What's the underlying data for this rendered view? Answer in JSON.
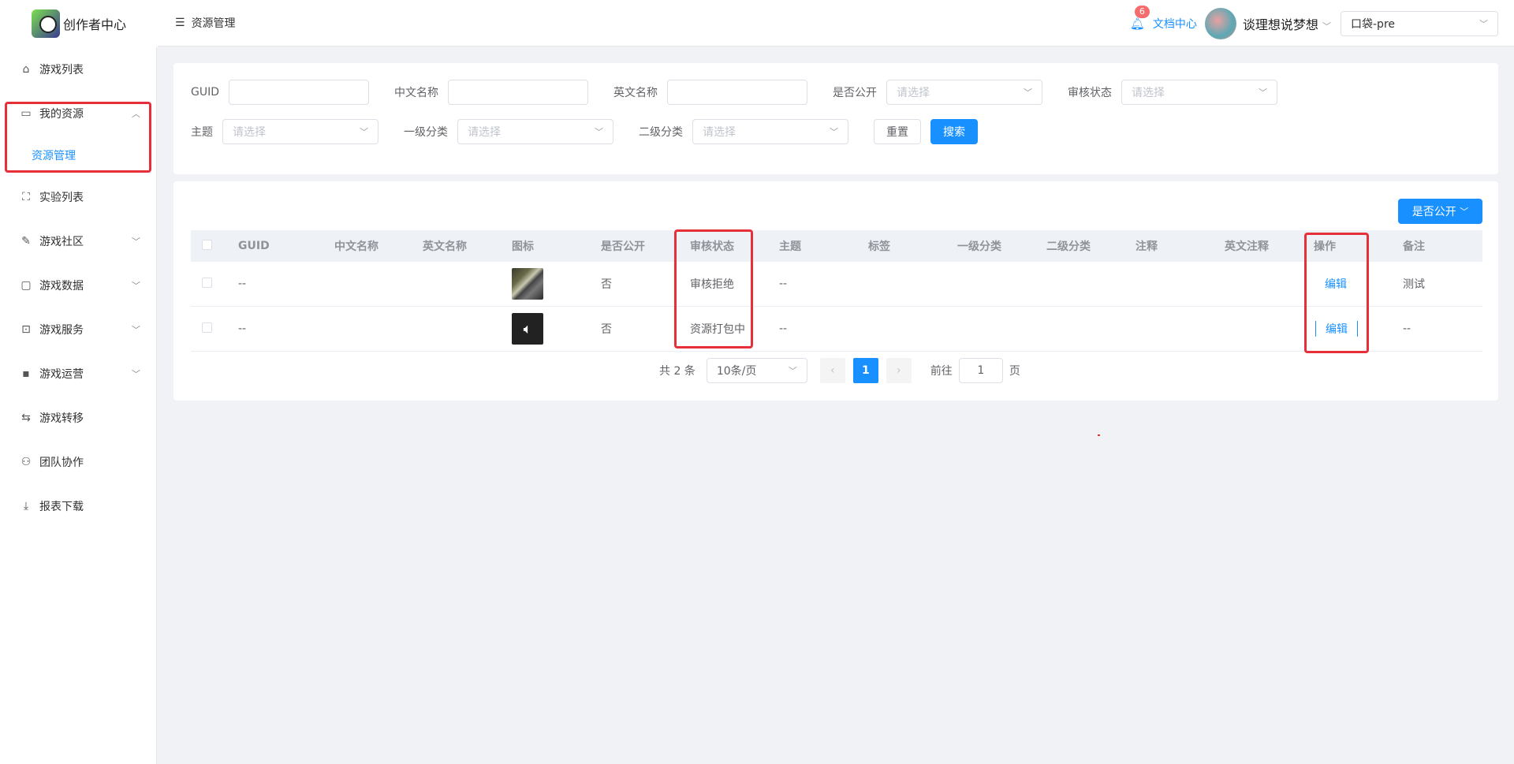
{
  "app": {
    "title": "创作者中心"
  },
  "header": {
    "breadcrumb": "资源管理",
    "notification_count": "6",
    "doc_link": "文档中心",
    "username": "谈理想说梦想",
    "project": "口袋-pre"
  },
  "sidebar": {
    "items": [
      {
        "label": "游戏列表",
        "icon": "home-icon",
        "has_arrow": false
      },
      {
        "label": "我的资源",
        "icon": "folder-icon",
        "has_arrow": true,
        "expanded": true
      },
      {
        "label": "实验列表",
        "icon": "experiment-icon",
        "has_arrow": false
      },
      {
        "label": "游戏社区",
        "icon": "pen-icon",
        "has_arrow": true
      },
      {
        "label": "游戏数据",
        "icon": "chart-icon",
        "has_arrow": true
      },
      {
        "label": "游戏服务",
        "icon": "service-icon",
        "has_arrow": true
      },
      {
        "label": "游戏运营",
        "icon": "message-icon",
        "has_arrow": true
      },
      {
        "label": "游戏转移",
        "icon": "transfer-icon",
        "has_arrow": false
      },
      {
        "label": "团队协作",
        "icon": "user-icon",
        "has_arrow": false
      },
      {
        "label": "报表下载",
        "icon": "download-icon",
        "has_arrow": false
      }
    ],
    "sub_item": "资源管理"
  },
  "filters": {
    "guid_label": "GUID",
    "cn_name_label": "中文名称",
    "en_name_label": "英文名称",
    "public_label": "是否公开",
    "review_label": "审核状态",
    "theme_label": "主题",
    "cat1_label": "一级分类",
    "cat2_label": "二级分类",
    "placeholder": "请选择",
    "reset": "重置",
    "search": "搜索"
  },
  "table": {
    "public_dropdown": "是否公开",
    "columns": [
      "GUID",
      "中文名称",
      "英文名称",
      "图标",
      "是否公开",
      "审核状态",
      "主题",
      "标签",
      "一级分类",
      "二级分类",
      "注释",
      "英文注释",
      "操作",
      "备注"
    ],
    "rows": [
      {
        "guid": "--",
        "cn_name": "",
        "en_name": "",
        "icon": "image-thumbnail",
        "public": "否",
        "review": "审核拒绝",
        "theme": "--",
        "tags": "",
        "cat1": "",
        "cat2": "",
        "note": "",
        "en_note": "",
        "action": "编辑",
        "remark": "测试"
      },
      {
        "guid": "--",
        "cn_name": "",
        "en_name": "",
        "icon": "audio-thumbnail",
        "public": "否",
        "review": "资源打包中",
        "theme": "--",
        "tags": "",
        "cat1": "",
        "cat2": "",
        "note": "",
        "en_note": "",
        "action": "编辑",
        "remark": "--"
      }
    ]
  },
  "pagination": {
    "total": "共 2 条",
    "page_size": "10条/页",
    "current": "1",
    "goto_label": "前往",
    "goto_value": "1",
    "page_suffix": "页"
  },
  "colors": {
    "primary": "#1890ff",
    "highlight": "#e5303a",
    "badge": "#f56c6c"
  }
}
